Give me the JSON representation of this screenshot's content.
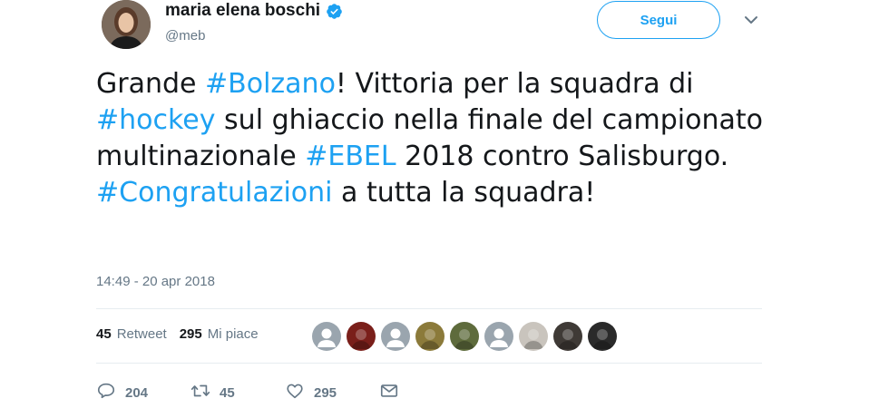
{
  "user": {
    "display_name": "maria elena boschi",
    "handle": "@meb",
    "avatar_icon": "profile-photo",
    "verified_icon": "verified-badge-icon"
  },
  "follow_label": "Segui",
  "tweet": {
    "segments": [
      {
        "t": "Grande ",
        "h": false
      },
      {
        "t": "#Bolzano",
        "h": true
      },
      {
        "t": "! Vittoria per la squadra di ",
        "h": false
      },
      {
        "t": "#hockey",
        "h": true
      },
      {
        "t": " sul ghiaccio nella finale del campionato multinazionale ",
        "h": false
      },
      {
        "t": "#EBEL",
        "h": true
      },
      {
        "t": " 2018 contro Salisburgo. ",
        "h": false
      },
      {
        "t": "#Congratulazioni",
        "h": true
      },
      {
        "t": " a tutta la squadra!",
        "h": false
      }
    ],
    "timestamp": "14:49 - 20 apr 2018"
  },
  "stats": {
    "retweet_count": "45",
    "retweet_label": "Retweet",
    "like_count": "295",
    "like_label": "Mi piace"
  },
  "likers": [
    {
      "icon": "default-avatar",
      "color": "#9aa5ae"
    },
    {
      "icon": "photo-avatar",
      "color": "#7a1f1a"
    },
    {
      "icon": "default-avatar",
      "color": "#9aa5ae"
    },
    {
      "icon": "photo-avatar",
      "color": "#8b7a3a"
    },
    {
      "icon": "photo-avatar",
      "color": "#5e6b3c"
    },
    {
      "icon": "default-avatar",
      "color": "#9aa5ae"
    },
    {
      "icon": "photo-avatar",
      "color": "#c9c4bd"
    },
    {
      "icon": "photo-avatar",
      "color": "#3f3a36"
    },
    {
      "icon": "photo-avatar",
      "color": "#2a2a2a"
    }
  ],
  "actions": {
    "reply_count": "204",
    "retweet_count": "45",
    "like_count": "295"
  },
  "colors": {
    "accent": "#1da1f2",
    "muted": "#657786",
    "text": "#14171a"
  }
}
